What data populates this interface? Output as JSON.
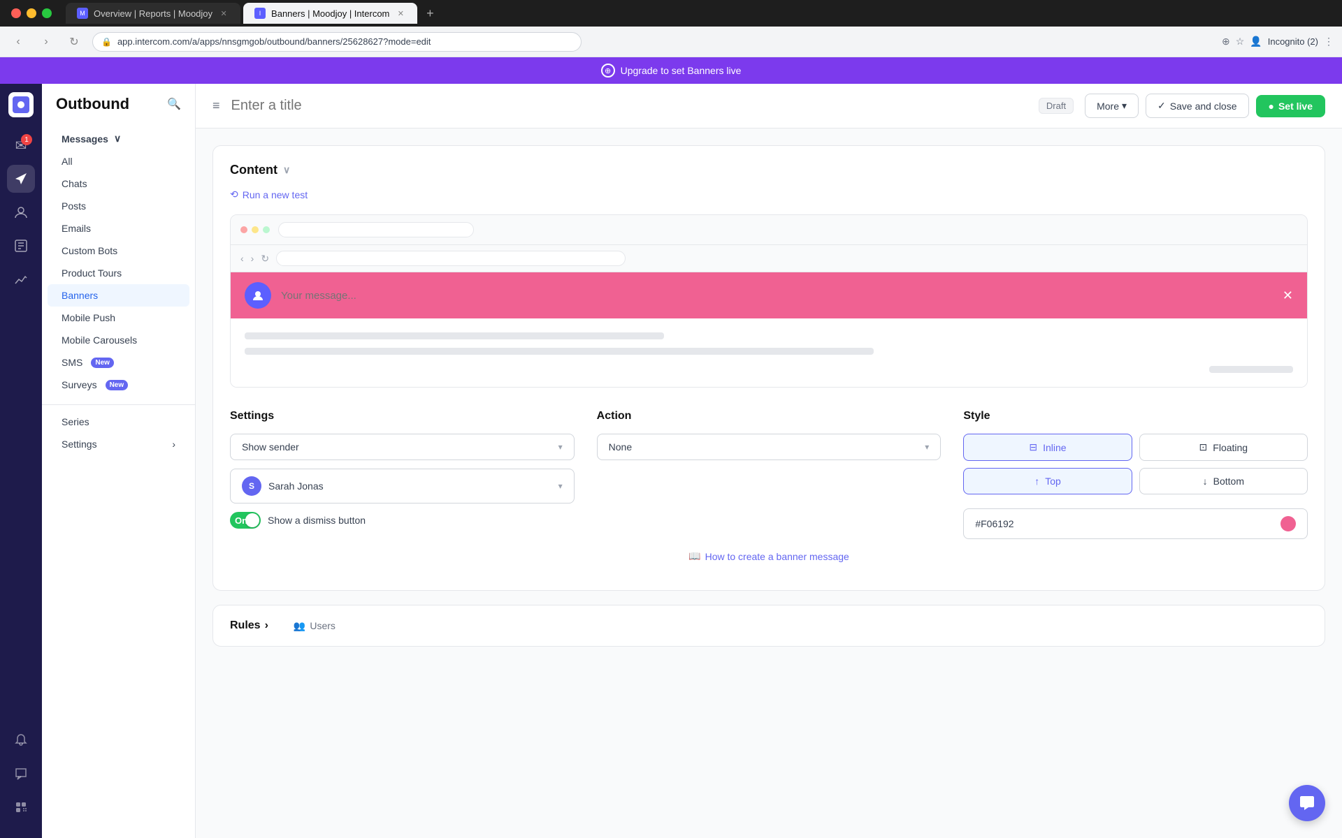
{
  "browser": {
    "tabs": [
      {
        "id": "tab1",
        "title": "Overview | Reports | Moodjoy",
        "favicon": "M",
        "active": false
      },
      {
        "id": "tab2",
        "title": "Banners | Moodjoy | Intercom",
        "favicon": "I",
        "active": true
      }
    ],
    "address": "app.intercom.com/a/apps/nnsgmgob/outbound/banners/25628627?mode=edit"
  },
  "upgrade_banner": {
    "text": "Upgrade to set Banners live",
    "icon": "+"
  },
  "left_rail": {
    "icons": [
      {
        "id": "home",
        "symbol": "⊞",
        "badge": null
      },
      {
        "id": "messages",
        "symbol": "✉",
        "badge": "1"
      },
      {
        "id": "outbound",
        "symbol": "➤",
        "badge": null,
        "active": true
      },
      {
        "id": "contacts",
        "symbol": "👤",
        "badge": null
      },
      {
        "id": "reports",
        "symbol": "📖",
        "badge": null
      },
      {
        "id": "analytics",
        "symbol": "📊",
        "badge": null
      }
    ],
    "bottom_icons": [
      {
        "id": "notifications",
        "symbol": "🔔",
        "badge": null
      },
      {
        "id": "chat",
        "symbol": "💬",
        "badge": null
      },
      {
        "id": "apps",
        "symbol": "⊞",
        "badge": null
      }
    ]
  },
  "sidebar": {
    "title": "Outbound",
    "messages_section": {
      "label": "Messages",
      "items": [
        {
          "id": "all",
          "label": "All"
        },
        {
          "id": "chats",
          "label": "Chats"
        },
        {
          "id": "posts",
          "label": "Posts"
        },
        {
          "id": "emails",
          "label": "Emails"
        },
        {
          "id": "custom-bots",
          "label": "Custom Bots"
        },
        {
          "id": "product-tours",
          "label": "Product Tours"
        },
        {
          "id": "banners",
          "label": "Banners",
          "active": true
        },
        {
          "id": "mobile-push",
          "label": "Mobile Push"
        },
        {
          "id": "mobile-carousels",
          "label": "Mobile Carousels"
        },
        {
          "id": "sms",
          "label": "SMS",
          "badge": "New"
        },
        {
          "id": "surveys",
          "label": "Surveys",
          "badge": "New"
        }
      ]
    },
    "series": "Series",
    "settings": "Settings"
  },
  "editor": {
    "title_placeholder": "Enter a title",
    "status": "Draft",
    "more_label": "More",
    "save_close_label": "Save and close",
    "set_live_label": "Set live"
  },
  "content_section": {
    "title": "Content",
    "run_test_label": "Run a new test",
    "banner_placeholder": "Your message..."
  },
  "settings_section": {
    "title": "Settings",
    "show_sender_label": "Show sender",
    "sender_name": "Sarah Jonas",
    "dismiss_label": "Show a dismiss button",
    "dismiss_on": true
  },
  "action_section": {
    "title": "Action",
    "option": "None"
  },
  "style_section": {
    "title": "Style",
    "inline_label": "Inline",
    "floating_label": "Floating",
    "top_label": "Top",
    "bottom_label": "Bottom",
    "color_value": "#F06192"
  },
  "help": {
    "link_label": "How to create a banner message"
  },
  "rules": {
    "title": "Rules",
    "users_label": "Users"
  },
  "chat_widget": {
    "symbol": "💬"
  }
}
